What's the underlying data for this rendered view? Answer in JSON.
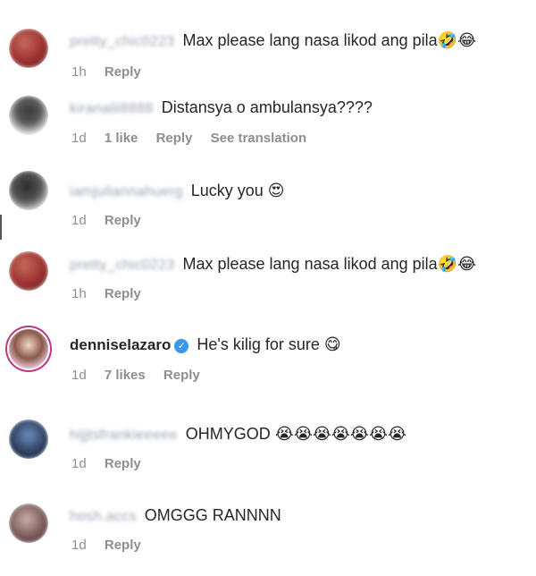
{
  "comments": [
    {
      "username": "pretty_chic0223",
      "text": "Max please lang nasa likod ang pila",
      "emojis": "🤣😂",
      "time": "1h",
      "reply_label": "Reply",
      "avatar_colors": [
        "#b23a3a",
        "#7a4a3a"
      ]
    },
    {
      "username": "kiranalii8888",
      "text": "Distansya o ambulansya????",
      "emojis": "",
      "time": "1d",
      "likes": "1 like",
      "reply_label": "Reply",
      "see_translation_label": "See translation",
      "avatar_colors": [
        "#d9d9d9",
        "#3a3a3a"
      ]
    },
    {
      "username": "iamjuliannahuerg",
      "text": "Lucky you",
      "emojis": "😍",
      "time": "1d",
      "reply_label": "Reply",
      "avatar_colors": [
        "#e0e0e0",
        "#2b2b2b"
      ]
    },
    {
      "username": "pretty_chic0223",
      "text": "Max please lang nasa likod ang pila",
      "emojis": "🤣😂",
      "time": "1h",
      "reply_label": "Reply",
      "avatar_colors": [
        "#b23a3a",
        "#7a4a3a"
      ]
    },
    {
      "username": "denniselazaro",
      "verified": true,
      "text": "He's kilig for sure",
      "emojis": "😋",
      "time": "1d",
      "likes": "7 likes",
      "reply_label": "Reply",
      "avatar_colors": [
        "#f3d1e0",
        "#7b4a3a"
      ]
    },
    {
      "username": "hijjtsfrankieeeee",
      "text": "OHMYGOD",
      "emojis": "😭😭😭😭😭😭😭",
      "time": "1d",
      "reply_label": "Reply",
      "avatar_colors": [
        "#2a3b5a",
        "#6a8cb8"
      ]
    },
    {
      "username": "hosh.accs",
      "text": "OMGGG RANNNN",
      "emojis": "",
      "time": "1d",
      "reply_label": "Reply",
      "avatar_colors": [
        "#c8b0a8",
        "#5a4a4a"
      ]
    }
  ]
}
